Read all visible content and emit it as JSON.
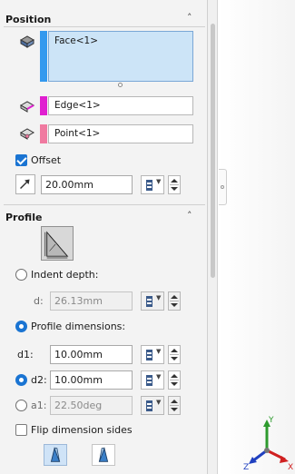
{
  "position_section": {
    "title": "Position",
    "face_selection": "Face<1>",
    "edge_selection": "Edge<1>",
    "point_selection": "Point<1>",
    "offset_label": "Offset",
    "offset_checked": true,
    "offset_value": "20.00mm"
  },
  "profile_section": {
    "title": "Profile",
    "indent_depth_label": "Indent depth:",
    "d_label": "d:",
    "d_value": "26.13mm",
    "profile_dimensions_label": "Profile dimensions:",
    "d1_label": "d1:",
    "d1_value": "10.00mm",
    "d2_label": "d2:",
    "d2_value": "10.00mm",
    "a1_label": "a1:",
    "a1_value": "22.50deg",
    "flip_label": "Flip dimension sides",
    "flip_checked": false,
    "selected_option": "Profile dimensions"
  },
  "triad": {
    "x": "X",
    "y": "Y",
    "z": "Z"
  },
  "colors": {
    "face": "#3399ee",
    "edge": "#e01fd0",
    "point": "#f07aa0",
    "accent": "#1a74d2"
  }
}
